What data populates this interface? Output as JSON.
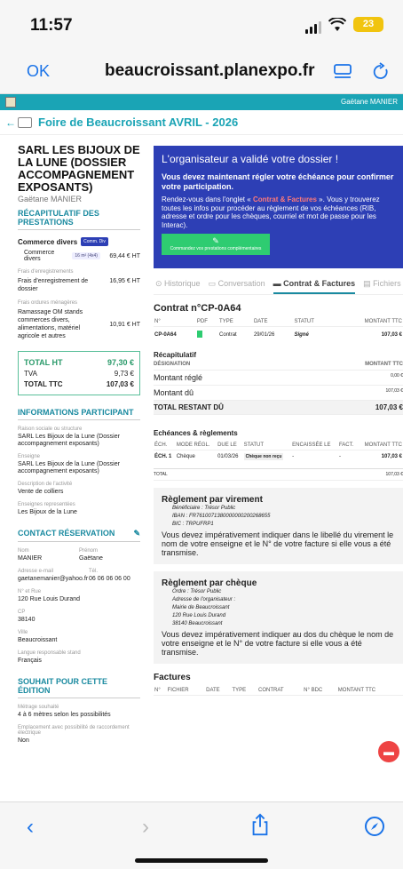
{
  "status": {
    "time": "11:57",
    "battery": "23"
  },
  "browser": {
    "ok": "OK",
    "domain": "beaucroissant.planexpo.fr"
  },
  "header": {
    "user": "Gaëtane MANIER",
    "fair_title": "Foire de Beaucroissant AVRIL - 2026"
  },
  "left": {
    "company": "SARL LES BIJOUX DE LA LUNE (DOSSIER ACCOMPAGNEMENT EXPOSANTS)",
    "manager": "Gaëtane MANIER",
    "recap_title": "RÉCAPITULATIF DES PRESTATIONS",
    "category": "Commerce divers",
    "category_badge": "Comm. Div",
    "item1": {
      "label": "Commerce divers",
      "tag": "16 m² (4x4)",
      "price": "69,44 € HT"
    },
    "g1": "Frais d'enregistrements",
    "item2": {
      "label": "Frais d'enregistrement de dossier",
      "price": "16,95 € HT"
    },
    "g2": "Frais ordures ménagères",
    "item3": {
      "label": "Ramassage OM stands commerces divers, alimentations, matériel agricole et autres",
      "price": "10,91 € HT"
    },
    "tot_ht_label": "TOTAL HT",
    "tot_ht": "97,30 €",
    "tva_label": "TVA",
    "tva": "9,73 €",
    "ttc_label": "TOTAL TTC",
    "ttc": "107,03 €",
    "info_title": "INFORMATIONS PARTICIPANT",
    "raison_label": "Raison sociale ou structure",
    "raison": "SARL Les Bijoux de la Lune (Dossier accompagnement exposants)",
    "enseigne_label": "Enseigne",
    "enseigne": "SARL Les Bijoux de la Lune (Dossier accompagnement exposants)",
    "activite_label": "Description de l'activité",
    "activite": "Vente de colliers",
    "ens_rep_label": "Enseignes representées",
    "ens_rep": "Les Bijoux de la Lune",
    "contact_title": "CONTACT RÉSERVATION",
    "nom_label": "Nom",
    "nom": "MANIER",
    "prenom_label": "Prénom",
    "prenom": "Gaëtane",
    "email_label": "Adresse e-mail",
    "email": "gaetanemanier@yahoo.fr",
    "tel_label": "Tél.",
    "tel": "06 06 06 06 00",
    "rue_label": "N° et Rue",
    "rue": "120 Rue Louis Durand",
    "cp_label": "CP",
    "cp": "38140",
    "ville_label": "Ville",
    "ville": "Beaucroissant",
    "langue_label": "Langue responsable stand",
    "langue": "Français",
    "souhait_title": "SOUHAIT POUR CETTE ÉDITION",
    "metrage_label": "Métrage souhaité",
    "metrage": "4 à 6 mètres selon les possibilités",
    "emp_label": "Emplacement avec possibilité de raccordement électrique",
    "emp": "Non"
  },
  "right": {
    "banner_title": "L'organisateur a validé votre dossier !",
    "banner_sub": "Vous devez maintenant régler votre échéance pour confirmer votre participation.",
    "banner_t1": "Rendez-vous dans l'onglet « ",
    "banner_t2": "Contrat & Factures",
    "banner_t3": " ». Vous y trouverez toutes les infos pour procéder au règlement de vos échéances (RIB, adresse et ordre pour les chèques, courriel et mot de passe pour les Interac).",
    "green_btn": "Commandez vos prestations complémentaires",
    "tabs": [
      "Historique",
      "Conversation",
      "Contrat & Factures",
      "Fichiers"
    ],
    "contract_title": "Contrat n°CP-0A64",
    "ct_head": [
      "N°",
      "PDF",
      "TYPE",
      "DATE",
      "STATUT",
      "MONTANT TTC"
    ],
    "ct_row": [
      "CP-0A64",
      "",
      "Contrat",
      "29/01/26",
      "Signé",
      "107,03 €"
    ],
    "recap": "Récapitulatif",
    "designation": "DÉSIGNATION",
    "montant_ttc": "MONTANT TTC",
    "regle_label": "Montant réglé",
    "regle": "0,00 €",
    "du_label": "Montant dû",
    "du": "107,03 €",
    "reste_label": "TOTAL RESTANT DÛ",
    "reste": "107,03 €",
    "ech_title": "Echéances & règlements",
    "ech_head": [
      "ÉCH.",
      "MODE RÉGL.",
      "DUE LE",
      "STATUT",
      "ENCAISSÉE LE",
      "FACT.",
      "MONTANT TTC"
    ],
    "ech_row": [
      "ÉCH. 1",
      "Chèque",
      "01/03/26",
      "Chèque non reçu",
      "-",
      "-",
      "107,03 €"
    ],
    "ech_total_label": "TOTAL",
    "ech_total": "107,03 €",
    "vir_title": "Règlement par virement",
    "vir_benef": "Bénéficiaire : Trésor Public",
    "vir_iban": "IBAN : FR7610071380000000200268655",
    "vir_bic": "BIC : TRPUFRP1",
    "vir_text": "Vous devez impérativement indiquer dans le libellé du virement le nom de votre enseigne et le N° de votre facture si elle vous a été transmise.",
    "chq_title": "Règlement par chèque",
    "chq_ordre": "Ordre : Trésor Public",
    "chq_adr": "Adresse de l'organisateur :",
    "chq_a1": "Mairie de Beaucroissant",
    "chq_a2": "120 Rue Louis Durand",
    "chq_a3": "38140 Beaucroissant",
    "chq_text": "Vous devez impérativement indiquer au dos du chèque le nom de votre enseigne et le N° de votre facture si elle vous a été transmise.",
    "fact_title": "Factures",
    "fact_head": [
      "N°",
      "FICHIER",
      "DATE",
      "TYPE",
      "CONTRAT",
      "N° BDC",
      "MONTANT TTC"
    ]
  },
  "colors": {
    "teal": "#1aa4b5",
    "blue": "#2d3fb5",
    "green": "#2ecc71",
    "ios_blue": "#1a73e8"
  }
}
